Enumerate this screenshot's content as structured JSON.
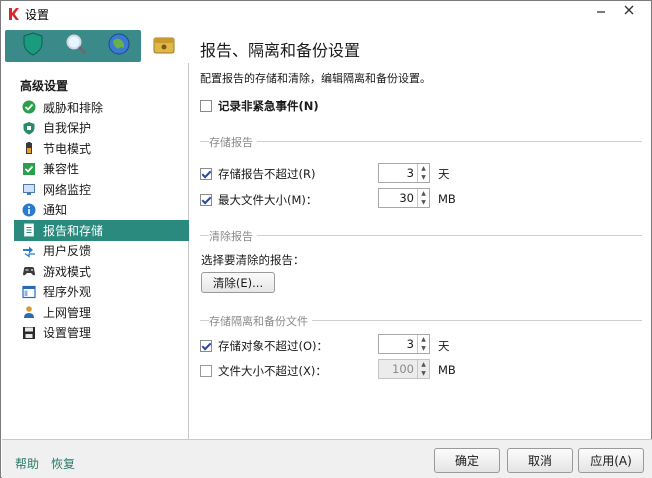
{
  "window": {
    "title": "设置"
  },
  "sidebar": {
    "section_title": "高级设置",
    "icon_tabs": [
      "protection-icon",
      "scan-icon",
      "update-icon",
      "advanced-icon"
    ],
    "items": [
      {
        "label": "威胁和排除",
        "icon": "check-icon"
      },
      {
        "label": "自我保护",
        "icon": "shield-icon"
      },
      {
        "label": "节电模式",
        "icon": "battery-icon"
      },
      {
        "label": "兼容性",
        "icon": "compat-icon"
      },
      {
        "label": "网络监控",
        "icon": "network-icon"
      },
      {
        "label": "通知",
        "icon": "info-icon"
      },
      {
        "label": "报告和存储",
        "icon": "report-icon",
        "active": true
      },
      {
        "label": "用户反馈",
        "icon": "feedback-icon"
      },
      {
        "label": "游戏模式",
        "icon": "gamepad-icon"
      },
      {
        "label": "程序外观",
        "icon": "appearance-icon"
      },
      {
        "label": "上网管理",
        "icon": "user-icon"
      },
      {
        "label": "设置管理",
        "icon": "save-icon"
      }
    ]
  },
  "main": {
    "title": "报告、隔离和备份设置",
    "description": "配置报告的存储和清除，编辑隔离和备份设置。",
    "log_noncritical": {
      "label": "记录非紧急事件(N)",
      "checked": false
    },
    "storage_reports": {
      "group_label": "存储报告",
      "keep_reports": {
        "label": "存储报告不超过(R)",
        "checked": true,
        "value": "3",
        "unit": "天"
      },
      "max_file_size": {
        "label": "最大文件大小(M)：",
        "checked": true,
        "value": "30",
        "unit": "MB"
      }
    },
    "clear_reports": {
      "group_label": "清除报告",
      "select_label": "选择要清除的报告：",
      "clear_button": "清除(E)..."
    },
    "quarantine": {
      "group_label": "存储隔离和备份文件",
      "keep_objects": {
        "label": "存储对象不超过(O)：",
        "checked": true,
        "value": "3",
        "unit": "天"
      },
      "file_size_limit": {
        "label": "文件大小不超过(X)：",
        "checked": false,
        "value": "100",
        "unit": "MB"
      }
    }
  },
  "footer": {
    "help": "帮助",
    "restore": "恢复",
    "ok": "确定",
    "cancel": "取消",
    "apply": "应用(A)"
  },
  "colors": {
    "accent": "#2a8a7e",
    "link": "#2a7a6a"
  }
}
